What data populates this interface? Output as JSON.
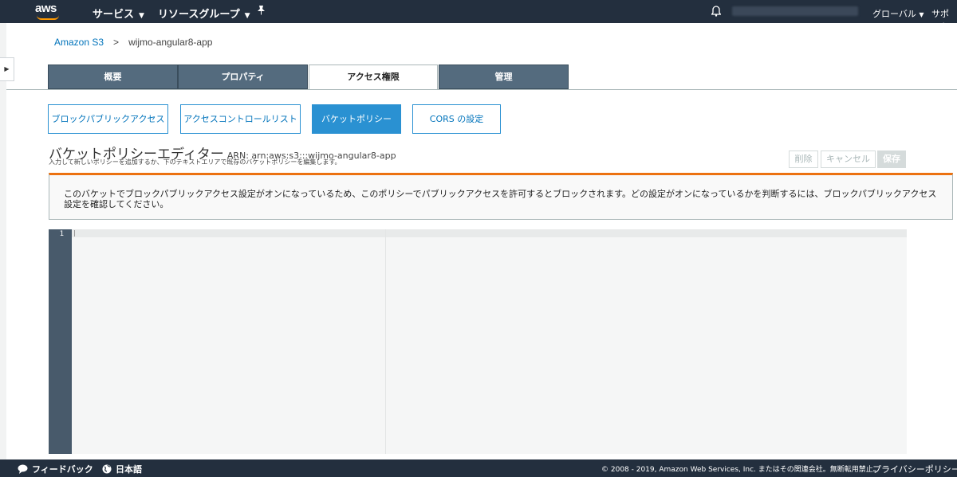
{
  "topnav": {
    "logo_text": "aws",
    "services": "サービス",
    "resource_groups": "リソースグループ",
    "region": "グローバル",
    "support": "サポート"
  },
  "breadcrumb": {
    "root": "Amazon S3",
    "separator": ">",
    "bucket": "wijmo-angular8-app"
  },
  "tabs": [
    {
      "label": "概要"
    },
    {
      "label": "プロパティ"
    },
    {
      "label": "アクセス権限",
      "active": true
    },
    {
      "label": "管理"
    }
  ],
  "subtabs": [
    {
      "label": "ブロックパブリックアクセス"
    },
    {
      "label": "アクセスコントロールリスト"
    },
    {
      "label": "バケットポリシー",
      "active": true
    },
    {
      "label": "CORS の設定"
    }
  ],
  "editor": {
    "title": "バケットポリシーエディター",
    "arn": "ARN: arn:aws:s3:::wijmo-angular8-app",
    "description": "入力して新しいポリシーを追加するか、下のテキストエリアで既存のバケットポリシーを編集します。",
    "delete_label": "削除",
    "cancel_label": "キャンセル",
    "save_label": "保存",
    "line_number": "1"
  },
  "warning": {
    "text": "このバケットでブロックパブリックアクセス設定がオンになっているため、このポリシーでパブリックアクセスを許可するとブロックされます。どの設定がオンになっているかを判断するには、ブロックパブリックアクセス設定を確認してください。",
    "accent_color": "#ec7211"
  },
  "footer": {
    "feedback": "フィードバック",
    "language": "日本語",
    "copyright": "© 2008 - 2019, Amazon Web Services, Inc. またはその関連会社。無断転用禁止。",
    "privacy": "プライバシーポリシー"
  },
  "colors": {
    "nav_bg": "#232f3e",
    "tab_bg": "#546b7e",
    "accent_blue": "#2a91d2",
    "link_blue": "#0073bb"
  }
}
